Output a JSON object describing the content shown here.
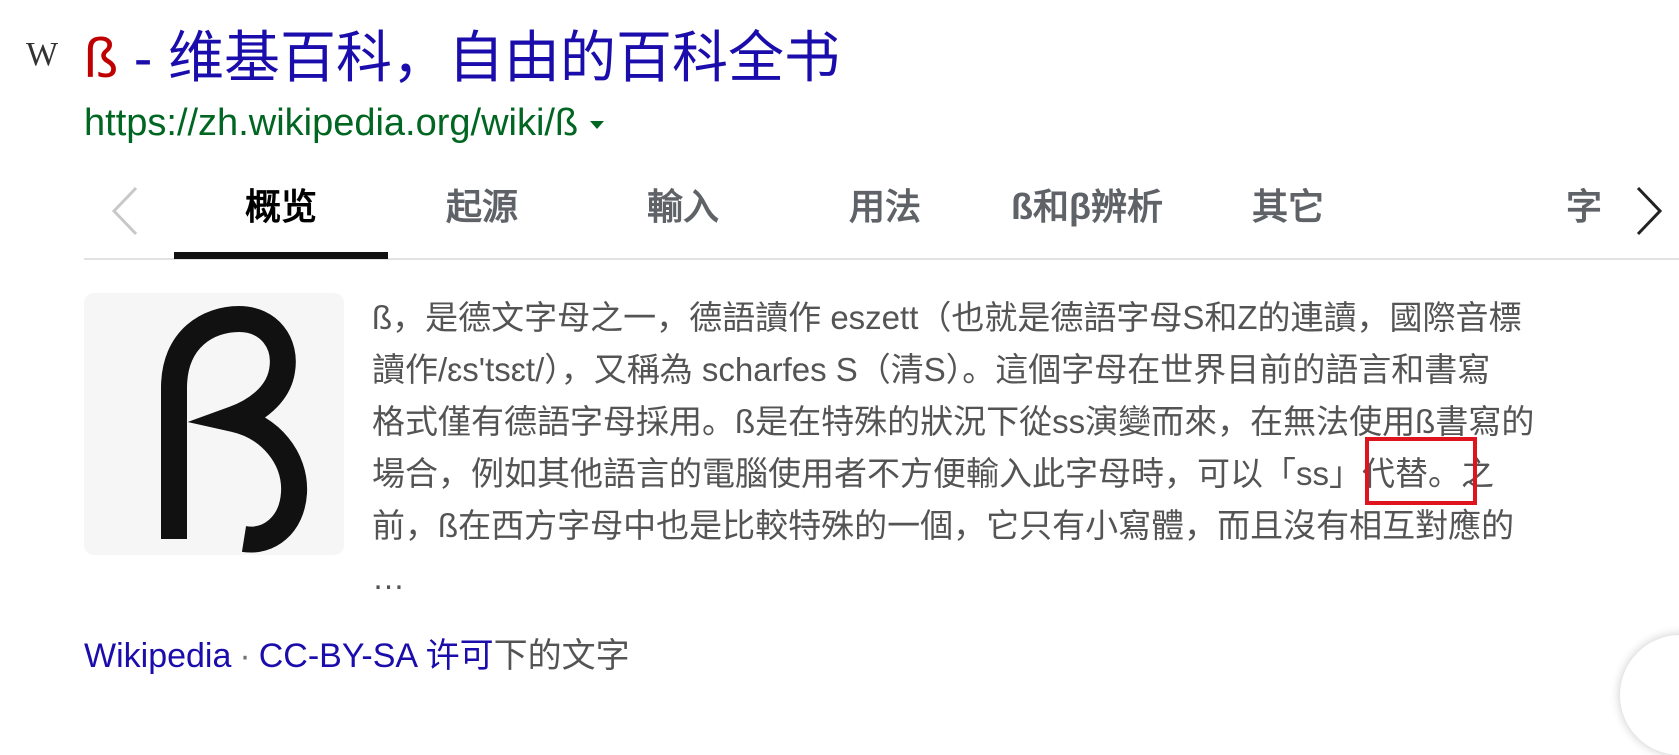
{
  "result": {
    "site_icon": "W",
    "title_highlight": "ß",
    "title_rest": " - 维基百科，自由的百科全书",
    "url": "https://zh.wikipedia.org/wiki/ß",
    "url_menu_icon": "caret-down-icon"
  },
  "tabs": {
    "items": [
      "概览",
      "起源",
      "輸入",
      "用法",
      "ß和β辨析",
      "其它",
      "字"
    ],
    "active_index": 0,
    "prev_icon": "chevron-left-icon",
    "next_icon": "chevron-right-icon"
  },
  "thumbnail": {
    "glyph": "ß",
    "icon": "eszett-glyph-image"
  },
  "snippet": {
    "lines": [
      "ß，是德文字母之一，德語讀作 eszett（也就是德語字母S和Z的連讀，國際音標",
      "讀作/ɛs'tsɛt/），又稱為 scharfes S（清S）。這個字母在世界目前的語言和書寫",
      "格式僅有德語字母採用。ß是在特殊的狀況下從ss演變而來，在無法使用ß書寫的",
      "場合，例如其他語言的電腦使用者不方便輸入此字母時，可以「ss」代替。之",
      "前，ß在西方字母中也是比較特殊的一個，它只有小寫體，而且沒有相互對應的",
      "…"
    ],
    "highlight_text": "「ss」"
  },
  "footer": {
    "source": "Wikipedia",
    "separator": "·",
    "license": "CC-BY-SA 许可",
    "tail": "下的文字"
  },
  "colors": {
    "link": "#1a0dab",
    "url": "#006621",
    "title_highlight": "#c00000",
    "annotation_box": "#e0141e"
  }
}
